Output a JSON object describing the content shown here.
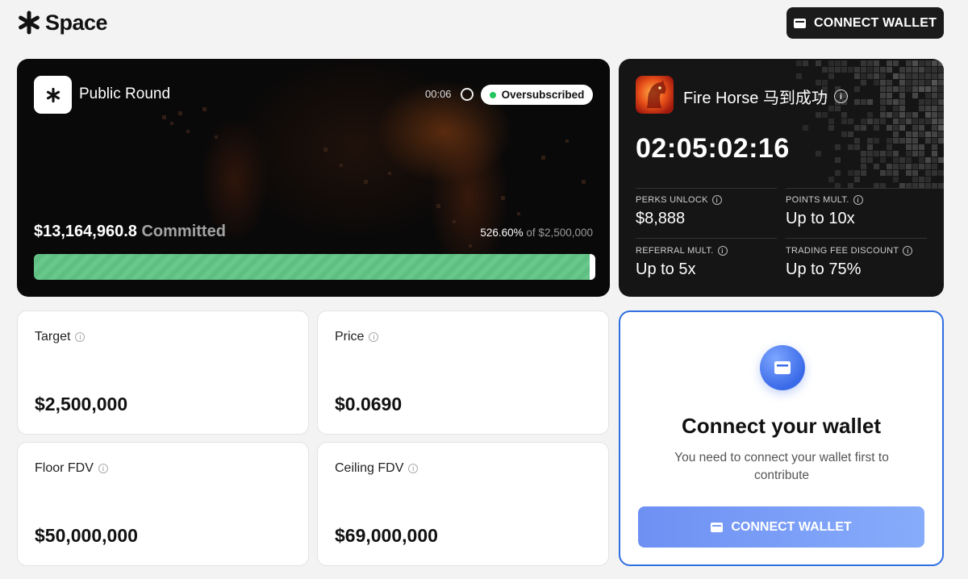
{
  "header": {
    "brand": "Space",
    "connect_label": "CONNECT WALLET"
  },
  "round": {
    "title": "Public Round",
    "timer": "00:06",
    "status": "Oversubscribed",
    "committed_amount": "$13,164,960.8",
    "committed_label": "Committed",
    "percent": "526.60%",
    "of_label": "of $2,500,000",
    "progress_fraction": 1.0
  },
  "event": {
    "title": "Fire Horse 马到成功",
    "countdown": "02:05:02:16",
    "stats": [
      {
        "label": "PERKS UNLOCK",
        "value": "$8,888"
      },
      {
        "label": "POINTS MULT.",
        "value": "Up to 10x"
      },
      {
        "label": "REFERRAL MULT.",
        "value": "Up to 5x"
      },
      {
        "label": "TRADING FEE DISCOUNT",
        "value": "Up to 75%"
      }
    ]
  },
  "metrics": [
    {
      "label": "Target",
      "value": "$2,500,000"
    },
    {
      "label": "Price",
      "value": "$0.0690"
    },
    {
      "label": "Floor FDV",
      "value": "$50,000,000"
    },
    {
      "label": "Ceiling FDV",
      "value": "$69,000,000"
    }
  ],
  "connect_panel": {
    "title": "Connect your wallet",
    "description": "You need to connect your wallet first to contribute",
    "button_label": "CONNECT WALLET"
  },
  "colors": {
    "accent_blue": "#2f6fe0",
    "progress_green": "#5fbf83",
    "status_green": "#22c55e",
    "dark_card": "#151515"
  }
}
